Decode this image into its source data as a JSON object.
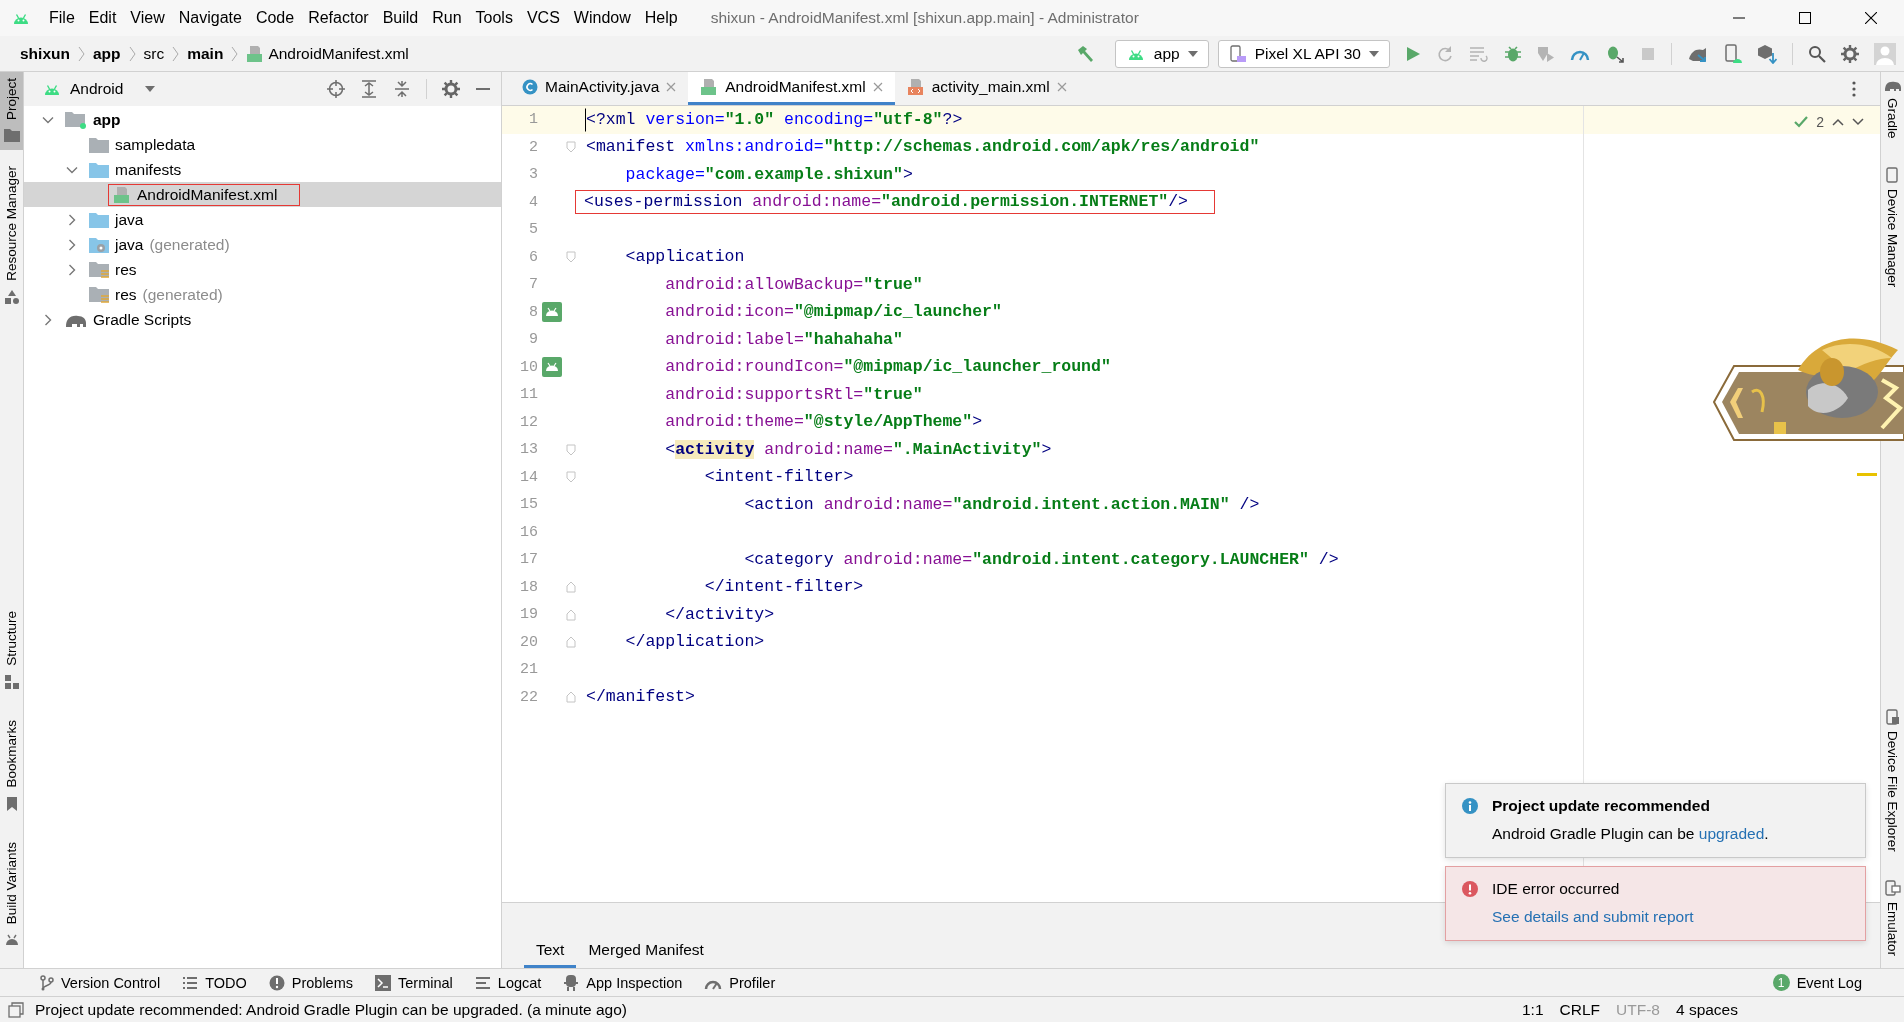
{
  "window": {
    "title": "shixun - AndroidManifest.xml [shixun.app.main] - Administrator"
  },
  "menu": [
    "File",
    "Edit",
    "View",
    "Navigate",
    "Code",
    "Refactor",
    "Build",
    "Run",
    "Tools",
    "VCS",
    "Window",
    "Help"
  ],
  "breadcrumb": [
    {
      "label": "shixun",
      "bold": true,
      "kind": "folder"
    },
    {
      "label": "app",
      "bold": true,
      "kind": "folder"
    },
    {
      "label": "src",
      "bold": false,
      "kind": "folder"
    },
    {
      "label": "main",
      "bold": true,
      "kind": "folder"
    },
    {
      "label": "AndroidManifest.xml",
      "bold": false,
      "kind": "manifest-file"
    }
  ],
  "toolbar": {
    "run_config": "app",
    "device": "Pixel XL API 30"
  },
  "left_tool_tabs": {
    "top": [
      {
        "label": "Project",
        "kind": "project",
        "selected": true
      },
      {
        "label": "Resource Manager",
        "kind": "resources",
        "selected": false
      }
    ],
    "bottom": [
      {
        "label": "Structure",
        "kind": "structure",
        "selected": false
      },
      {
        "label": "Bookmarks",
        "kind": "bookmarks",
        "selected": false
      },
      {
        "label": "Build Variants",
        "kind": "variants",
        "selected": false
      }
    ]
  },
  "project": {
    "view": "Android",
    "tree": [
      {
        "label": "app",
        "kind": "module",
        "expanded": true,
        "selected": false,
        "children": [
          {
            "label": "sampledata",
            "kind": "folder",
            "selected": false
          },
          {
            "label": "manifests",
            "kind": "source-folder",
            "expanded": true,
            "selected": false,
            "children": [
              {
                "label": "AndroidManifest.xml",
                "kind": "manifest-file",
                "selected": true,
                "boxed": true
              }
            ]
          },
          {
            "label": "java",
            "kind": "source-folder",
            "expanded": false,
            "selected": false
          },
          {
            "label": "java",
            "note": "(generated)",
            "kind": "generated-folder",
            "expanded": false,
            "selected": false
          },
          {
            "label": "res",
            "kind": "res-folder",
            "expanded": false,
            "selected": false
          },
          {
            "label": "res",
            "note": "(generated)",
            "kind": "res-folder",
            "selected": false
          }
        ]
      },
      {
        "label": "Gradle Scripts",
        "kind": "gradle",
        "expanded": false,
        "selected": false
      }
    ]
  },
  "editor": {
    "tabs": [
      {
        "label": "MainActivity.java",
        "kind": "java",
        "selected": false
      },
      {
        "label": "AndroidManifest.xml",
        "kind": "manifest",
        "selected": true
      },
      {
        "label": "activity_main.xml",
        "kind": "layout",
        "selected": false
      }
    ],
    "inspections": "2",
    "lines": [
      {
        "number": "1",
        "current": true,
        "boxed": false,
        "gutter_icon": false,
        "fold_start": false,
        "fold_end": false,
        "tokens": [
          {
            "kind": "tag",
            "text": "<?xml "
          },
          {
            "kind": "attr",
            "text": "version="
          },
          {
            "kind": "value",
            "text": "\"1.0\""
          },
          {
            "kind": "attr",
            "text": " encoding="
          },
          {
            "kind": "value",
            "text": "\"utf-8\""
          },
          {
            "kind": "tag",
            "text": "?>"
          }
        ]
      },
      {
        "number": "2",
        "current": false,
        "boxed": false,
        "gutter_icon": false,
        "fold_start": true,
        "fold_end": false,
        "tokens": [
          {
            "kind": "tag",
            "text": "<manifest "
          },
          {
            "kind": "attr",
            "text": "xmlns:android="
          },
          {
            "kind": "value",
            "text": "\"http://schemas.android.com/apk/res/android\""
          }
        ]
      },
      {
        "number": "3",
        "current": false,
        "boxed": false,
        "gutter_icon": false,
        "fold_start": false,
        "fold_end": false,
        "tokens": [
          {
            "kind": "attr",
            "text": "    package="
          },
          {
            "kind": "value",
            "text": "\"com.example.shixun\""
          },
          {
            "kind": "tag",
            "text": ">"
          }
        ]
      },
      {
        "number": "4",
        "current": false,
        "boxed": true,
        "gutter_icon": false,
        "fold_start": false,
        "fold_end": false,
        "tokens": [
          {
            "kind": "tag",
            "text": "<uses-permission "
          },
          {
            "kind": "ns",
            "text": "android:name="
          },
          {
            "kind": "value",
            "text": "\"android.permission.INTERNET\""
          },
          {
            "kind": "tag",
            "text": "/>"
          }
        ]
      },
      {
        "number": "5",
        "current": false,
        "boxed": false,
        "gutter_icon": false,
        "fold_start": false,
        "fold_end": false
      },
      {
        "number": "6",
        "current": false,
        "boxed": false,
        "gutter_icon": false,
        "fold_start": true,
        "fold_end": false,
        "tokens": [
          {
            "kind": "tag",
            "text": "    <application"
          }
        ]
      },
      {
        "number": "7",
        "current": false,
        "boxed": false,
        "gutter_icon": false,
        "fold_start": false,
        "fold_end": false,
        "tokens": [
          {
            "kind": "ns",
            "text": "        android:allowBackup="
          },
          {
            "kind": "value",
            "text": "\"true\""
          }
        ]
      },
      {
        "number": "8",
        "current": false,
        "boxed": false,
        "gutter_icon": true,
        "fold_start": false,
        "fold_end": false,
        "tokens": [
          {
            "kind": "ns",
            "text": "        android:icon="
          },
          {
            "kind": "value",
            "text": "\"@mipmap/ic_launcher\""
          }
        ]
      },
      {
        "number": "9",
        "current": false,
        "boxed": false,
        "gutter_icon": false,
        "fold_start": false,
        "fold_end": false,
        "tokens": [
          {
            "kind": "ns",
            "text": "        android:label="
          },
          {
            "kind": "value",
            "text": "\"hahahaha\""
          }
        ]
      },
      {
        "number": "10",
        "current": false,
        "boxed": false,
        "gutter_icon": true,
        "fold_start": false,
        "fold_end": false,
        "tokens": [
          {
            "kind": "ns",
            "text": "        android:roundIcon="
          },
          {
            "kind": "value",
            "text": "\"@mipmap/ic_launcher_round\""
          }
        ]
      },
      {
        "number": "11",
        "current": false,
        "boxed": false,
        "gutter_icon": false,
        "fold_start": false,
        "fold_end": false,
        "tokens": [
          {
            "kind": "ns",
            "text": "        android:supportsRtl="
          },
          {
            "kind": "value",
            "text": "\"true\""
          }
        ]
      },
      {
        "number": "12",
        "current": false,
        "boxed": false,
        "gutter_icon": false,
        "fold_start": false,
        "fold_end": false,
        "tokens": [
          {
            "kind": "ns",
            "text": "        android:theme="
          },
          {
            "kind": "value",
            "text": "\"@style/AppTheme\""
          },
          {
            "kind": "tag",
            "text": ">"
          }
        ]
      },
      {
        "number": "13",
        "current": false,
        "boxed": false,
        "gutter_icon": false,
        "fold_start": true,
        "fold_end": false,
        "tokens": [
          {
            "kind": "tag",
            "text": "        <"
          },
          {
            "kind": "match",
            "text": "activity"
          },
          {
            "kind": "ns",
            "text": " android:name="
          },
          {
            "kind": "value",
            "text": "\".MainActivity\""
          },
          {
            "kind": "tag",
            "text": ">"
          }
        ]
      },
      {
        "number": "14",
        "current": false,
        "boxed": false,
        "gutter_icon": false,
        "fold_start": true,
        "fold_end": false,
        "tokens": [
          {
            "kind": "tag",
            "text": "            <intent-filter>"
          }
        ]
      },
      {
        "number": "15",
        "current": false,
        "boxed": false,
        "gutter_icon": false,
        "fold_start": false,
        "fold_end": false,
        "tokens": [
          {
            "kind": "tag",
            "text": "                <action "
          },
          {
            "kind": "ns",
            "text": "android:name="
          },
          {
            "kind": "value",
            "text": "\"android.intent.action.MAIN\""
          },
          {
            "kind": "tag",
            "text": " />"
          }
        ]
      },
      {
        "number": "16",
        "current": false,
        "boxed": false,
        "gutter_icon": false,
        "fold_start": false,
        "fold_end": false
      },
      {
        "number": "17",
        "current": false,
        "boxed": false,
        "gutter_icon": false,
        "fold_start": false,
        "fold_end": false,
        "tokens": [
          {
            "kind": "tag",
            "text": "                <category "
          },
          {
            "kind": "ns",
            "text": "android:name="
          },
          {
            "kind": "value",
            "text": "\"android.intent.category.LAUNCHER\""
          },
          {
            "kind": "tag",
            "text": " />"
          }
        ]
      },
      {
        "number": "18",
        "current": false,
        "boxed": false,
        "gutter_icon": false,
        "fold_start": false,
        "fold_end": true,
        "tokens": [
          {
            "kind": "tag",
            "text": "            </intent-filter>"
          }
        ]
      },
      {
        "number": "19",
        "current": false,
        "boxed": false,
        "gutter_icon": false,
        "fold_start": false,
        "fold_end": true,
        "tokens": [
          {
            "kind": "tag",
            "text": "        </activity>"
          }
        ]
      },
      {
        "number": "20",
        "current": false,
        "boxed": false,
        "gutter_icon": false,
        "fold_start": false,
        "fold_end": true,
        "tokens": [
          {
            "kind": "tag",
            "text": "    </application>"
          }
        ]
      },
      {
        "number": "21",
        "current": false,
        "boxed": false,
        "gutter_icon": false,
        "fold_start": false,
        "fold_end": false
      },
      {
        "number": "22",
        "current": false,
        "boxed": false,
        "gutter_icon": false,
        "fold_start": false,
        "fold_end": true,
        "tokens": [
          {
            "kind": "tag",
            "text": "</manifest>"
          }
        ]
      }
    ],
    "bottom_tabs": [
      {
        "label": "Text",
        "selected": true
      },
      {
        "label": "Merged Manifest",
        "selected": false
      }
    ]
  },
  "right_tool_tabs": {
    "top": [
      {
        "label": "Gradle",
        "kind": "gradle"
      },
      {
        "label": "Device Manager",
        "kind": "device"
      }
    ],
    "bottom": [
      {
        "label": "Device File Explorer",
        "kind": "files"
      },
      {
        "label": "Emulator",
        "kind": "emulator"
      }
    ]
  },
  "notifications": [
    {
      "kind": "info",
      "title": "Project update recommended",
      "text": "Android Gradle Plugin can be ",
      "link": "upgraded",
      "text_after": "."
    },
    {
      "kind": "error",
      "title": "IDE error occurred",
      "link": "See details and submit report"
    }
  ],
  "tool_windows": [
    {
      "label": "Version Control",
      "kind": "vcs"
    },
    {
      "label": "TODO",
      "kind": "todo"
    },
    {
      "label": "Problems",
      "kind": "problems"
    },
    {
      "label": "Terminal",
      "kind": "terminal"
    },
    {
      "label": "Logcat",
      "kind": "logcat"
    },
    {
      "label": "App Inspection",
      "kind": "inspection"
    },
    {
      "label": "Profiler",
      "kind": "profiler"
    }
  ],
  "event_log": {
    "label": "Event Log",
    "badge": "1"
  },
  "status_bar": {
    "message": "Project update recommended: Android Gradle Plugin can be upgraded. (a minute ago)",
    "items": [
      {
        "text": "1:1",
        "dim": false
      },
      {
        "text": "CRLF",
        "dim": false
      },
      {
        "text": "UTF-8",
        "dim": true
      },
      {
        "text": "4 spaces",
        "dim": false
      }
    ]
  }
}
